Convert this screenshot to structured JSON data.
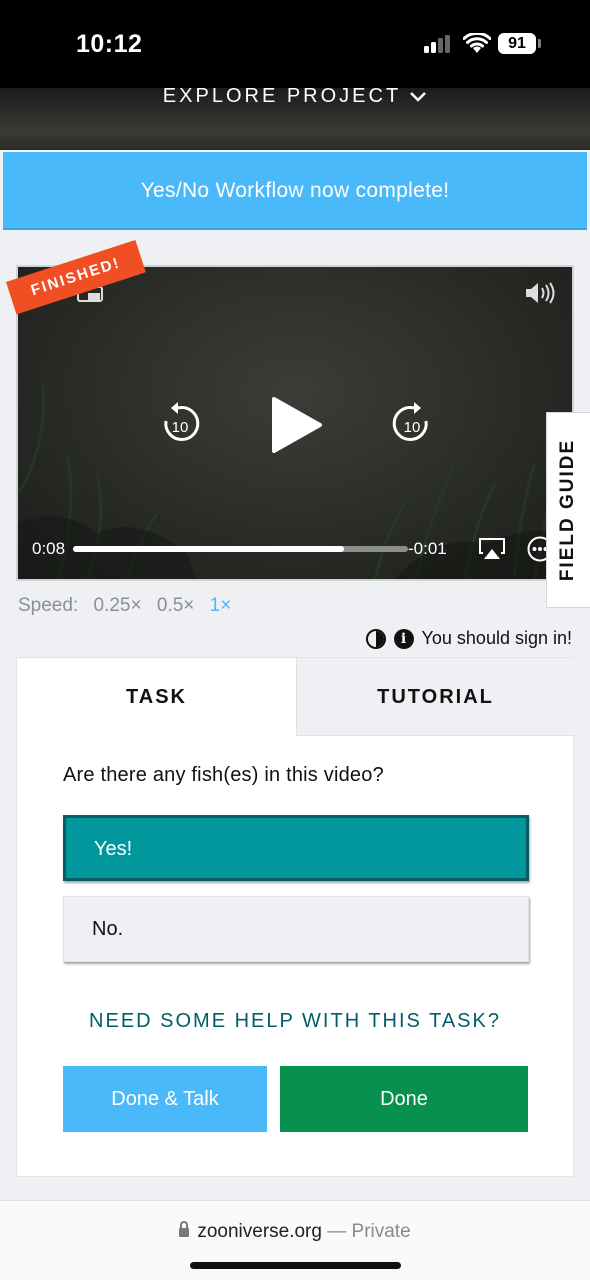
{
  "status_bar": {
    "time": "10:12",
    "battery": "91"
  },
  "header": {
    "explore_label": "EXPLORE PROJECT"
  },
  "banner": {
    "text": "Yes/No Workflow now complete!"
  },
  "video": {
    "finished_label": "FINISHED!",
    "current_time": "0:08",
    "remaining_time": "-0:01",
    "progress": 0.81,
    "skip_back_label": "10",
    "skip_forward_label": "10"
  },
  "field_guide": {
    "label": "FIELD GUIDE"
  },
  "speed": {
    "label": "Speed:",
    "options": [
      "0.25×",
      "0.5×",
      "1×"
    ],
    "selected": "1×"
  },
  "sign_in": {
    "text": "You should sign in!"
  },
  "tabs": {
    "task": "TASK",
    "tutorial": "TUTORIAL"
  },
  "task": {
    "question": "Are there any fish(es) in this video?",
    "answers": [
      "Yes!",
      "No."
    ],
    "help_link": "NEED SOME HELP WITH THIS TASK?",
    "done_talk_label": "Done & Talk",
    "done_label": "Done"
  },
  "browser": {
    "domain": "zooniverse.org",
    "separator": "—",
    "mode": "Private"
  },
  "colors": {
    "accent_blue": "#4ab9f9",
    "teal": "#00979d",
    "green": "#08904e",
    "orange": "#f04e23"
  }
}
